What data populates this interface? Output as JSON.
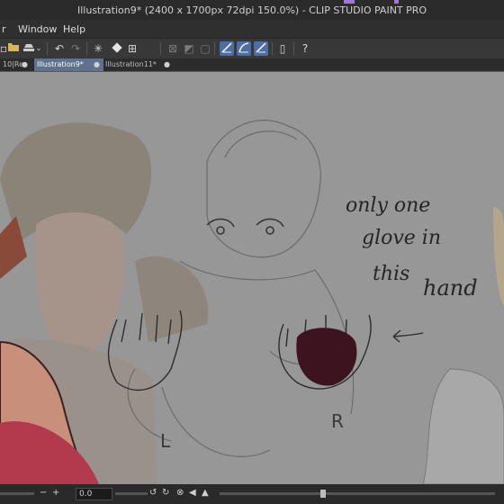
{
  "window": {
    "title": "Illustration9* (2400 x 1700px 72dpi 150.0%)  - CLIP STUDIO PAINT PRO",
    "accent": "#a079d8"
  },
  "menu": {
    "partial": "r",
    "items": [
      "Window",
      "Help"
    ]
  },
  "toolbar": {
    "icons": [
      "new-file-icon",
      "open-folder-icon",
      "save-icon",
      "dropdown-icon",
      "undo-icon",
      "redo-icon",
      "loading-icon",
      "fill-icon",
      "transform-icon",
      "deselect-icon",
      "invert-selection-icon",
      "selection-box-icon",
      "stabilizer-line-icon",
      "stabilizer-curve-icon",
      "stabilizer-smooth-icon",
      "device-icon",
      "help-icon"
    ]
  },
  "tabs": [
    {
      "label": "10|Re",
      "active": false
    },
    {
      "label": "Illustration9*",
      "active": true
    },
    {
      "label": "Illustration11*",
      "active": false
    }
  ],
  "canvas": {
    "note_lines": [
      "only one",
      "glove in",
      "this",
      "hand"
    ],
    "label_left": "L",
    "label_right": "R",
    "bg_color": "#979797",
    "glove_color": "#3d1320"
  },
  "statusbar": {
    "zoom_value": "0.0",
    "minus": "−",
    "plus": "+"
  }
}
